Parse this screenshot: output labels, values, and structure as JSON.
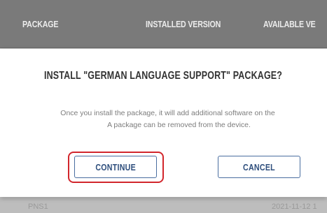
{
  "table": {
    "columns": [
      "PACKAGE",
      "INSTALLED VERSION",
      "AVAILABLE VE"
    ],
    "partial_row": {
      "name": "PNS1",
      "date": "2021-11-12 1"
    }
  },
  "dialog": {
    "title": "INSTALL \"GERMAN LANGUAGE SUPPORT\" PACKAGE?",
    "message_line1": "Once you install the package, it will add additional software on the",
    "message_line2": "A package can be removed from the device.",
    "continue_label": "CONTINUE",
    "cancel_label": "CANCEL"
  },
  "colors": {
    "header_bg": "#7a7a7a",
    "button_border": "#4a6ea0",
    "highlight": "#d2262c"
  }
}
